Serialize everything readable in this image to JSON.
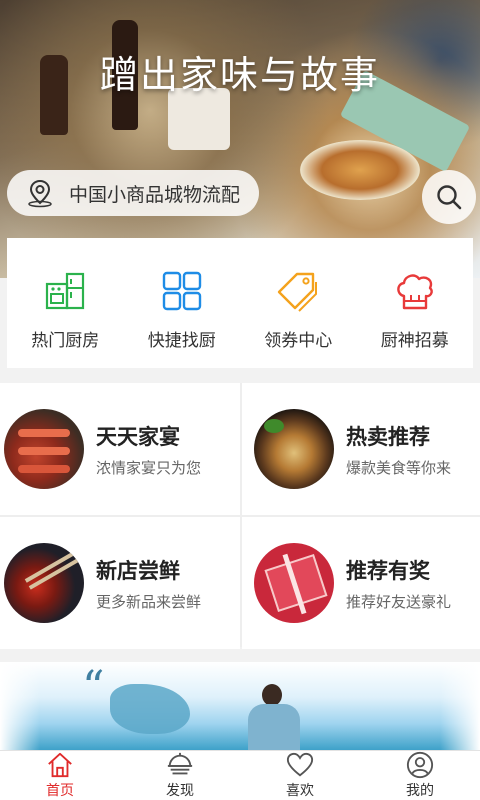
{
  "hero": {
    "slogan": "蹭出家味与故事",
    "location": "中国小商品城物流配",
    "location_icon": "map-pin-icon",
    "search_icon": "search-icon"
  },
  "quick_entries": [
    {
      "label": "热门厨房",
      "icon": "kitchen-icon",
      "color": "#2bb24c"
    },
    {
      "label": "快捷找厨",
      "icon": "grid-icon",
      "color": "#1e8ce6"
    },
    {
      "label": "领券中心",
      "icon": "coupon-tag-icon",
      "color": "#f4a21c"
    },
    {
      "label": "厨神招募",
      "icon": "chef-hat-icon",
      "color": "#e83a3a"
    }
  ],
  "cards": [
    {
      "title": "天天家宴",
      "subtitle": "浓情家宴只为您"
    },
    {
      "title": "热卖推荐",
      "subtitle": "爆款美食等你来"
    },
    {
      "title": "新店尝鲜",
      "subtitle": "更多新品来尝鲜"
    },
    {
      "title": "推荐有奖",
      "subtitle": "推荐好友送豪礼"
    }
  ],
  "banner": {
    "quote_mark": "“"
  },
  "tabs": [
    {
      "label": "首页",
      "icon": "home-icon",
      "active": true
    },
    {
      "label": "发现",
      "icon": "discover-bowl-icon",
      "active": false
    },
    {
      "label": "喜欢",
      "icon": "heart-icon",
      "active": false
    },
    {
      "label": "我的",
      "icon": "user-icon",
      "active": false
    }
  ],
  "colors": {
    "active_tab": "#e02a2a",
    "inactive_icon": "#555555"
  }
}
